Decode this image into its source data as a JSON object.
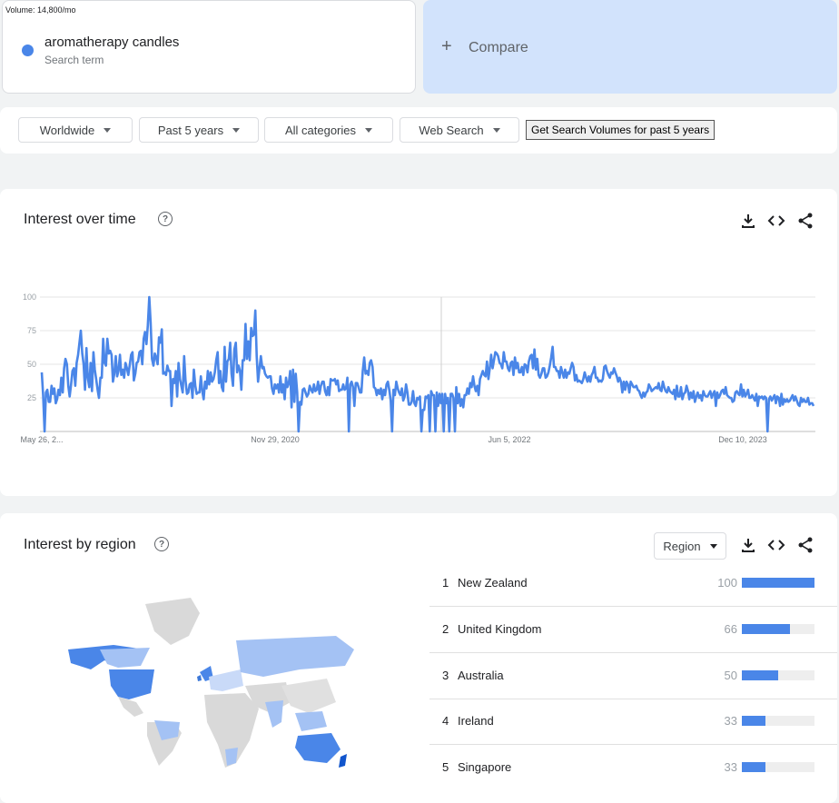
{
  "volume_label": "Volume: 14,800/mo",
  "term": {
    "name": "aromatherapy candles",
    "sub": "Search term",
    "color": "#4a86e8"
  },
  "compare": {
    "label": "Compare"
  },
  "filters": {
    "location": "Worldwide",
    "time": "Past 5 years",
    "category": "All categories",
    "search_type": "Web Search",
    "get_volumes": "Get Search Volumes for past 5 years"
  },
  "interest_over_time": {
    "title": "Interest over time"
  },
  "chart_data": {
    "type": "line",
    "title": "",
    "xlabel": "",
    "ylabel": "",
    "ylim": [
      0,
      100
    ],
    "yticks": [
      25,
      50,
      75,
      100
    ],
    "xtick_labels": [
      "May 26, 2...",
      "Nov 29, 2020",
      "Jun 5, 2022",
      "Dec 10, 2023"
    ],
    "grid": true,
    "line_color": "#4a86e8",
    "series": [
      {
        "values": [
          44,
          27,
          0,
          29,
          31,
          22,
          22,
          34,
          28,
          32,
          21,
          24,
          31,
          27,
          40,
          29,
          47,
          54,
          50,
          34,
          26,
          35,
          45,
          47,
          34,
          51,
          57,
          66,
          75,
          58,
          50,
          31,
          62,
          40,
          33,
          51,
          30,
          59,
          46,
          39,
          31,
          25,
          40,
          40,
          69,
          51,
          49,
          69,
          58,
          60,
          57,
          37,
          43,
          56,
          41,
          45,
          57,
          42,
          46,
          40,
          51,
          47,
          42,
          49,
          57,
          59,
          38,
          43,
          51,
          52,
          59,
          60,
          50,
          69,
          74,
          65,
          79,
          100,
          81,
          54,
          49,
          58,
          55,
          50,
          70,
          66,
          76,
          43,
          44,
          42,
          49,
          45,
          45,
          19,
          39,
          36,
          45,
          26,
          51,
          39,
          34,
          29,
          56,
          38,
          28,
          29,
          35,
          36,
          25,
          46,
          34,
          28,
          29,
          29,
          41,
          30,
          24,
          37,
          32,
          45,
          35,
          44,
          37,
          39,
          44,
          53,
          59,
          36,
          45,
          33,
          30,
          63,
          37,
          52,
          54,
          66,
          43,
          34,
          61,
          66,
          44,
          49,
          45,
          31,
          53,
          53,
          80,
          54,
          67,
          53,
          77,
          71,
          72,
          90,
          56,
          37,
          47,
          56,
          47,
          48,
          43,
          41,
          40,
          41,
          41,
          32,
          28,
          35,
          32,
          35,
          29,
          41,
          29,
          35,
          24,
          40,
          33,
          36,
          45,
          18,
          46,
          22,
          43,
          29,
          0,
          22,
          20,
          31,
          32,
          29,
          26,
          28,
          34,
          31,
          29,
          35,
          30,
          31,
          37,
          28,
          34,
          37,
          37,
          30,
          27,
          33,
          27,
          39,
          38,
          38,
          39,
          35,
          38,
          30,
          31,
          31,
          35,
          31,
          32,
          40,
          0,
          35,
          37,
          33,
          19,
          36,
          36,
          33,
          29,
          29,
          45,
          55,
          43,
          45,
          42,
          51,
          53,
          48,
          33,
          32,
          27,
          31,
          28,
          32,
          24,
          31,
          27,
          35,
          37,
          31,
          23,
          0,
          31,
          27,
          37,
          32,
          29,
          27,
          32,
          23,
          26,
          35,
          29,
          20,
          20,
          22,
          30,
          21,
          19,
          25,
          24,
          26,
          0,
          16,
          16,
          26,
          25,
          27,
          0,
          30,
          27,
          27,
          0,
          29,
          19,
          28,
          21,
          28,
          0,
          28,
          21,
          25,
          0,
          28,
          28,
          25,
          0,
          33,
          21,
          28,
          19,
          24,
          18,
          27,
          27,
          32,
          28,
          36,
          33,
          41,
          34,
          30,
          34,
          27,
          39,
          42,
          45,
          42,
          41,
          52,
          39,
          47,
          57,
          47,
          53,
          59,
          58,
          56,
          51,
          50,
          47,
          59,
          52,
          52,
          47,
          45,
          51,
          52,
          42,
          55,
          47,
          51,
          44,
          44,
          48,
          42,
          50,
          49,
          44,
          52,
          56,
          57,
          47,
          61,
          46,
          54,
          42,
          40,
          43,
          47,
          47,
          40,
          41,
          44,
          49,
          55,
          63,
          48,
          48,
          45,
          45,
          40,
          48,
          44,
          40,
          46,
          40,
          44,
          43,
          47,
          51,
          48,
          38,
          42,
          37,
          38,
          37,
          36,
          39,
          44,
          40,
          37,
          41,
          37,
          42,
          44,
          48,
          40,
          40,
          37,
          38,
          37,
          39,
          48,
          49,
          45,
          42,
          40,
          44,
          43,
          47,
          44,
          41,
          37,
          40,
          37,
          29,
          37,
          31,
          37,
          35,
          29,
          37,
          35,
          33,
          33,
          34,
          31,
          30,
          27,
          25,
          29,
          26,
          29,
          30,
          35,
          33,
          30,
          31,
          32,
          33,
          32,
          36,
          31,
          30,
          37,
          33,
          30,
          29,
          33,
          30,
          29,
          28,
          31,
          24,
          34,
          26,
          26,
          33,
          24,
          28,
          29,
          34,
          30,
          24,
          29,
          25,
          30,
          22,
          26,
          29,
          25,
          27,
          23,
          30,
          27,
          26,
          26,
          28,
          30,
          25,
          28,
          30,
          19,
          29,
          25,
          27,
          30,
          31,
          28,
          33,
          27,
          26,
          25,
          25,
          22,
          23,
          29,
          30,
          28,
          27,
          35,
          26,
          31,
          26,
          28,
          31,
          25,
          25,
          27,
          25,
          23,
          28,
          19,
          26,
          25,
          26,
          24,
          26,
          25,
          0,
          24,
          26,
          23,
          25,
          27,
          21,
          26,
          25,
          19,
          28,
          20,
          24,
          22,
          24,
          22,
          23,
          25,
          27,
          23,
          26,
          23,
          20,
          19,
          25,
          22,
          24,
          22,
          22,
          25,
          20,
          21,
          21,
          19
        ]
      }
    ]
  },
  "interest_by_region": {
    "title": "Interest by region",
    "select_value": "Region",
    "rows": [
      {
        "rank": "1",
        "name": "New Zealand",
        "value": "100",
        "fraction": 1.0
      },
      {
        "rank": "2",
        "name": "United Kingdom",
        "value": "66",
        "fraction": 0.66
      },
      {
        "rank": "3",
        "name": "Australia",
        "value": "50",
        "fraction": 0.5
      },
      {
        "rank": "4",
        "name": "Ireland",
        "value": "33",
        "fraction": 0.33
      },
      {
        "rank": "5",
        "name": "Singapore",
        "value": "33",
        "fraction": 0.33
      }
    ]
  },
  "icons": {
    "download": "download-icon",
    "embed": "embed-icon",
    "share": "share-icon",
    "help": "help-icon"
  }
}
